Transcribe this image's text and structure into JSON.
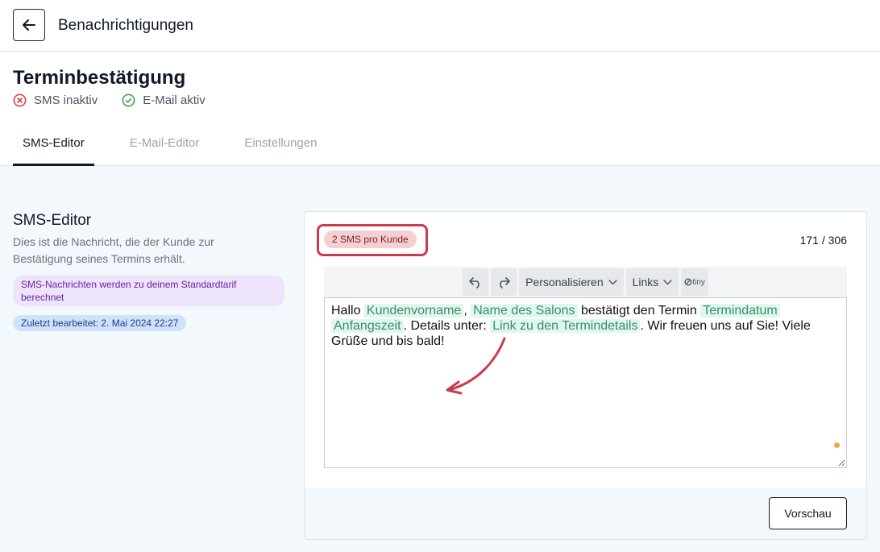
{
  "topbar": {
    "title": "Benachrichtigungen"
  },
  "header": {
    "title": "Terminbestätigung",
    "status": [
      {
        "label": "SMS inaktiv",
        "icon": "x-circle-icon",
        "color": "#d64545"
      },
      {
        "label": "E-Mail aktiv",
        "icon": "check-circle-icon",
        "color": "#3aa35b"
      }
    ]
  },
  "tabs": [
    {
      "label": "SMS-Editor",
      "active": true
    },
    {
      "label": "E-Mail-Editor",
      "active": false
    },
    {
      "label": "Einstellungen",
      "active": false
    }
  ],
  "side": {
    "title": "SMS-Editor",
    "description": "Dies ist die Nachricht, die der Kunde zur Bestätigung seines Termins erhält.",
    "tariff_note": "SMS-Nachrichten werden zu deinem Standardtarif berechnet",
    "last_edited": "Zuletzt bearbeitet: 2. Mai 2024 22:27"
  },
  "editor": {
    "sms_count": "2 SMS pro Kunde",
    "char_count": "171 / 306",
    "toolbar": {
      "undo_icon": "undo-icon",
      "redo_icon": "redo-icon",
      "personalize": "Personalisieren",
      "links": "Links",
      "brand": "tiny"
    },
    "message": {
      "t1": "Hallo ",
      "tag1": "Kundenvorname",
      "t2": ", ",
      "tag2": "Name des Salons",
      "t3": " bestätigt den Termin ",
      "tag3": "Termindatum",
      "t4": " ",
      "tag4": "Anfangszeit",
      "t5": ". Details unter: ",
      "tag5": "Link zu den Termindetails",
      "t6": ". Wir freuen uns auf Sie! Viele Grüße und bis bald!"
    },
    "preview_button": "Vorschau"
  },
  "colors": {
    "accent_red": "#cc3b4d",
    "background": "#f3f8fd",
    "tag_bg": "#dff7ec"
  }
}
